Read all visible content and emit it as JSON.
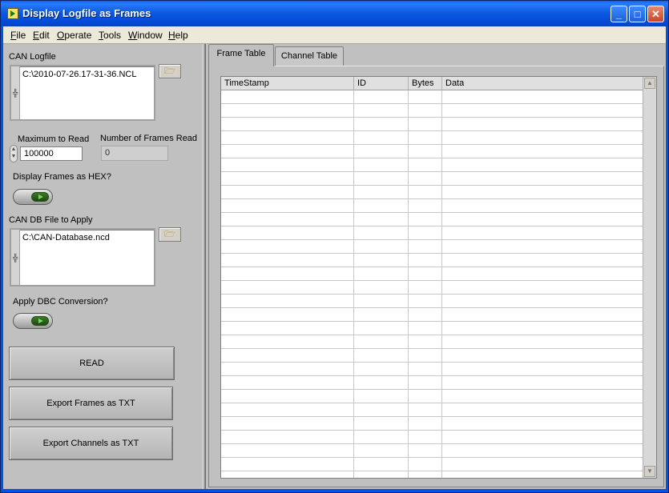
{
  "window": {
    "title": "Display Logfile as Frames"
  },
  "menu": [
    "File",
    "Edit",
    "Operate",
    "Tools",
    "Window",
    "Help"
  ],
  "controls": {
    "can_logfile_label": "CAN Logfile",
    "can_logfile_value": "C:\\2010-07-26.17-31-36.NCL",
    "max_read_label": "Maximum to Read",
    "max_read_value": "100000",
    "frames_read_label": "Number of Frames Read",
    "frames_read_value": "0",
    "hex_label": "Display Frames as HEX?",
    "candb_label": "CAN DB File to Apply",
    "candb_value": "C:\\CAN-Database.ncd",
    "dbc_label": "Apply DBC Conversion?"
  },
  "buttons": {
    "read": "READ",
    "export_frames": "Export Frames as TXT",
    "export_channels": "Export Channels as TXT"
  },
  "tabs": [
    "Frame Table",
    "Channel Table"
  ],
  "table": {
    "columns": [
      "TimeStamp",
      "ID",
      "Bytes",
      "Data"
    ]
  }
}
